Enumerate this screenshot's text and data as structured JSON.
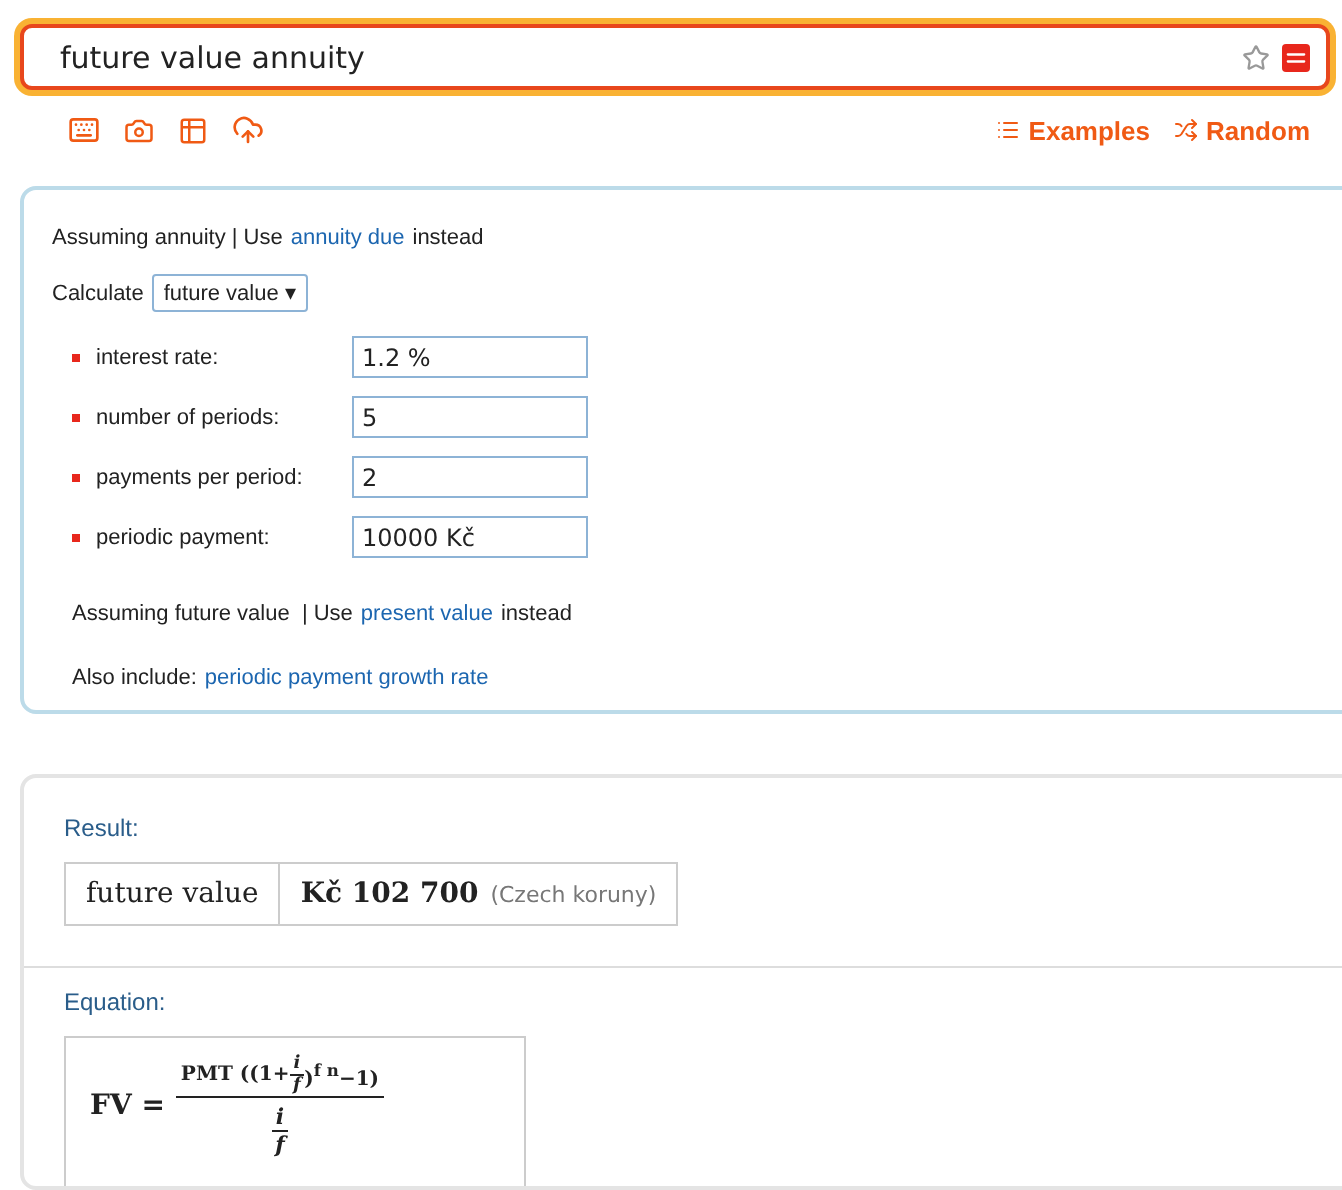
{
  "search": {
    "value": "future value annuity"
  },
  "toolbar": {
    "links": [
      {
        "kind": "examples",
        "label": "Examples"
      },
      {
        "kind": "random",
        "label": "Random"
      }
    ]
  },
  "assumptions": {
    "assuming": {
      "prefix": "Assuming annuity | Use",
      "link": "annuity due",
      "suffix": "instead"
    },
    "calculate": {
      "label": "Calculate",
      "value": "future value",
      "caret": "▾"
    },
    "inputs": [
      {
        "label": "interest rate:",
        "value": "1.2 %"
      },
      {
        "label": "number of periods:",
        "value": "5"
      },
      {
        "label": "payments per period:",
        "value": "2"
      },
      {
        "label": "periodic payment:",
        "value": "10000 Kč"
      }
    ],
    "assuming_value": {
      "prefix": "Assuming future value  | Use",
      "link": "present value",
      "suffix": "instead"
    },
    "also_include": {
      "label": "Also include:",
      "link": "periodic payment growth rate"
    }
  },
  "result": {
    "title": "Result:",
    "name": "future value",
    "value": "Kč 102 700",
    "unit": "(Czech koruny)"
  },
  "equation": {
    "title": "Equation:",
    "lhs": "FV",
    "equals": "=",
    "num_prefix": "PMT ((1+",
    "inner_num": "i",
    "inner_den": "f",
    "num_suffix": ")$^{f n}$−1)",
    "den_num": "i",
    "den_den": "f"
  }
}
